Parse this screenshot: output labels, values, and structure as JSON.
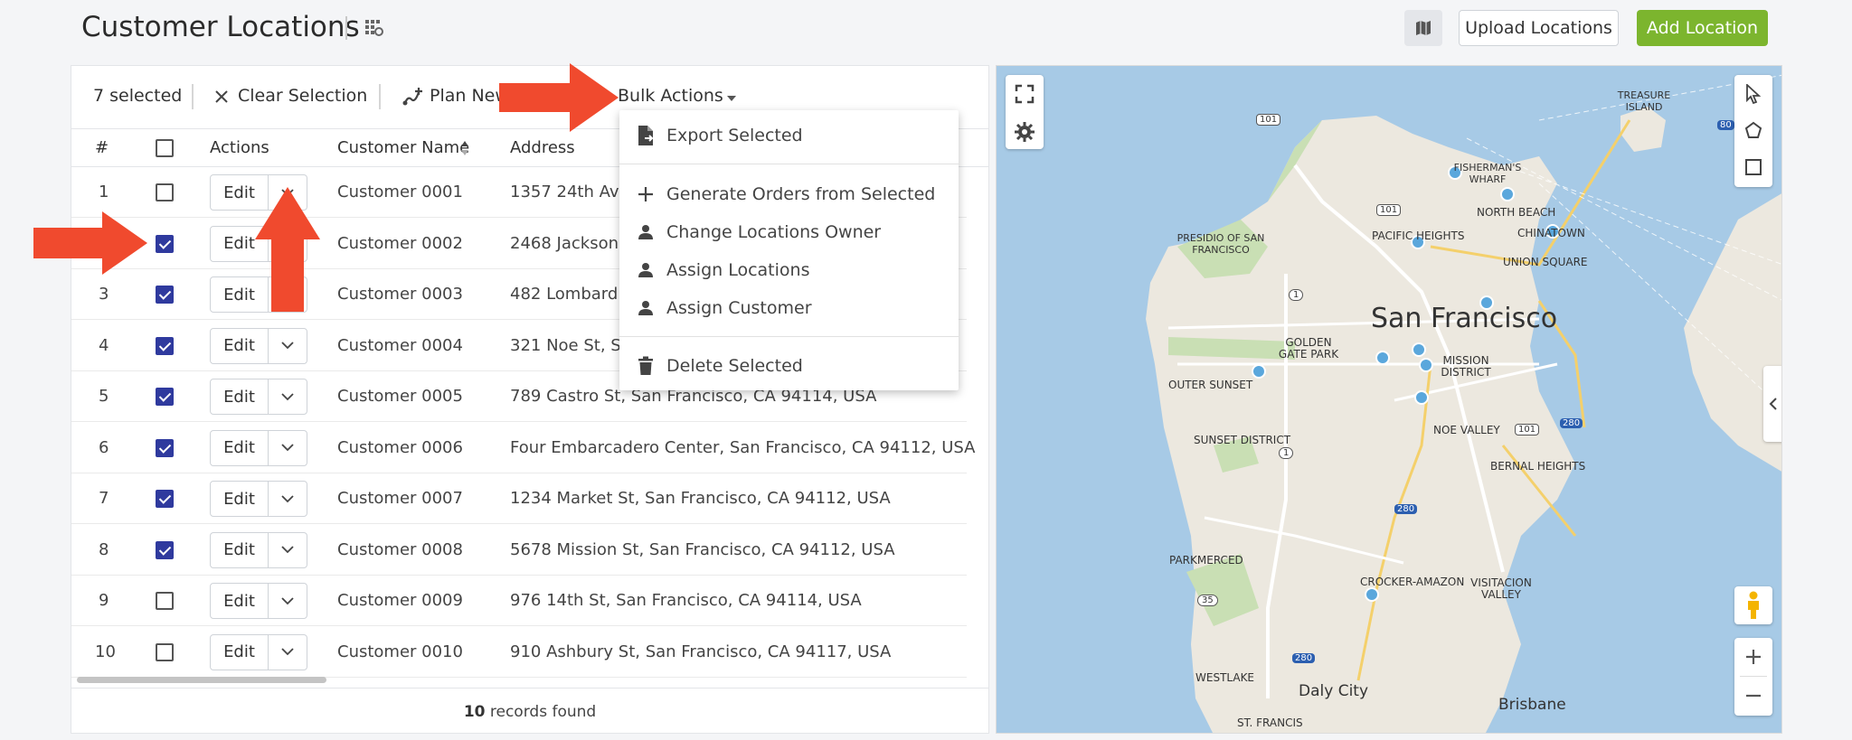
{
  "header": {
    "title": "Customer Locations",
    "upload_label": "Upload Locations",
    "add_label": "Add Location"
  },
  "toolbar": {
    "selected_count": "7 selected",
    "clear_label": "Clear Selection",
    "plan_label": "Plan New",
    "bulk_label": "Bulk Actions"
  },
  "table": {
    "columns": [
      "#",
      "Actions",
      "Customer Name",
      "Address"
    ],
    "edit_label": "Edit",
    "rows": [
      {
        "num": "1",
        "name": "Customer 0001",
        "address": "1357 24th Ave,",
        "checked": false
      },
      {
        "num": "2",
        "name": "Customer 0002",
        "address": "2468 Jackson S",
        "checked": true
      },
      {
        "num": "3",
        "name": "Customer 0003",
        "address": "482 Lombard S",
        "checked": true
      },
      {
        "num": "4",
        "name": "Customer 0004",
        "address": "321 Noe St, San",
        "checked": true
      },
      {
        "num": "5",
        "name": "Customer 0005",
        "address": "789 Castro St, San Francisco, CA 94114, USA",
        "checked": true
      },
      {
        "num": "6",
        "name": "Customer 0006",
        "address": "Four Embarcadero Center, San Francisco, CA 94112, USA",
        "checked": true
      },
      {
        "num": "7",
        "name": "Customer 0007",
        "address": "1234 Market St, San Francisco, CA 94112, USA",
        "checked": true
      },
      {
        "num": "8",
        "name": "Customer 0008",
        "address": "5678 Mission St, San Francisco, CA 94112, USA",
        "checked": true
      },
      {
        "num": "9",
        "name": "Customer 0009",
        "address": "976 14th St, San Francisco, CA 94114, USA",
        "checked": false
      },
      {
        "num": "10",
        "name": "Customer 0010",
        "address": "910 Ashbury St, San Francisco, CA 94117, USA",
        "checked": false
      }
    ],
    "footer_count": "10",
    "footer_text": "records found"
  },
  "bulk_menu": {
    "items": [
      {
        "label": "Export Selected",
        "icon": "file-export-icon"
      },
      {
        "label": "Generate Orders from Selected",
        "icon": "plus-icon"
      },
      {
        "label": "Change Locations Owner",
        "icon": "person-icon"
      },
      {
        "label": "Assign Locations",
        "icon": "person-icon"
      },
      {
        "label": "Assign Customer",
        "icon": "person-icon"
      },
      {
        "label": "Delete Selected",
        "icon": "trash-icon"
      }
    ]
  },
  "map": {
    "city_label": "San Francisco",
    "labels": [
      "TREASURE ISLAND",
      "FISHERMAN'S WHARF",
      "NORTH BEACH",
      "CHINATOWN",
      "PACIFIC HEIGHTS",
      "PRESIDIO OF SAN FRANCISCO",
      "UNION SQUARE",
      "GOLDEN GATE PARK",
      "OUTER SUNSET",
      "MISSION DISTRICT",
      "NOE VALLEY",
      "SUNSET DISTRICT",
      "BERNAL HEIGHTS",
      "PARKMERCED",
      "CROCKER-AMAZON",
      "VISITACION VALLEY",
      "WESTLAKE",
      "Daly City",
      "Brisbane",
      "ST. FRANCIS"
    ],
    "route_shields": [
      "101",
      "101",
      "1",
      "1",
      "101",
      "280",
      "280",
      "280",
      "80",
      "35"
    ]
  },
  "colors": {
    "accent_green": "#7cb52e",
    "checkbox_blue": "#2f3a9e",
    "arrow_red": "#f04a2e",
    "map_water": "#a7cae6",
    "map_land": "#ece8df",
    "marker": "#5aa7dc"
  }
}
